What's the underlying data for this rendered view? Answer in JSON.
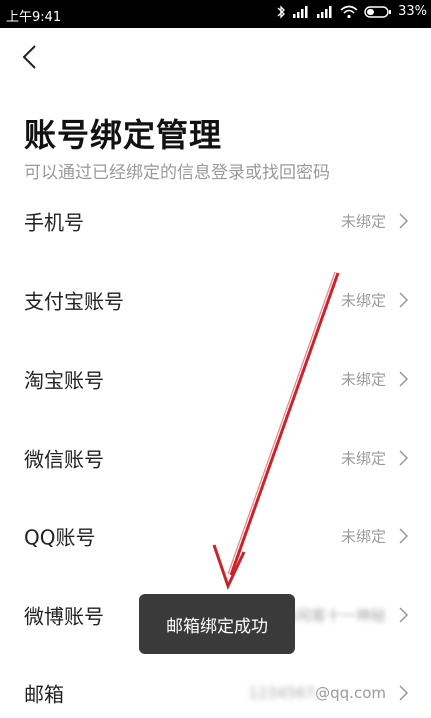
{
  "status_bar": {
    "time": "上午9:41",
    "battery": "33%"
  },
  "page": {
    "title": "账号绑定管理",
    "subtitle": "可以通过已经绑定的信息登录或找回密码"
  },
  "rows": [
    {
      "label": "手机号",
      "value": "未绑定"
    },
    {
      "label": "支付宝账号",
      "value": "未绑定"
    },
    {
      "label": "淘宝账号",
      "value": "未绑定"
    },
    {
      "label": "微信账号",
      "value": "未绑定"
    },
    {
      "label": "QQ账号",
      "value": "未绑定"
    },
    {
      "label": "微博账号",
      "value": "休闲客十一神秘"
    },
    {
      "label": "邮箱",
      "value": "@qq.com",
      "value_blurred_prefix": "1234567"
    }
  ],
  "toast": {
    "message": "邮箱绑定成功"
  }
}
